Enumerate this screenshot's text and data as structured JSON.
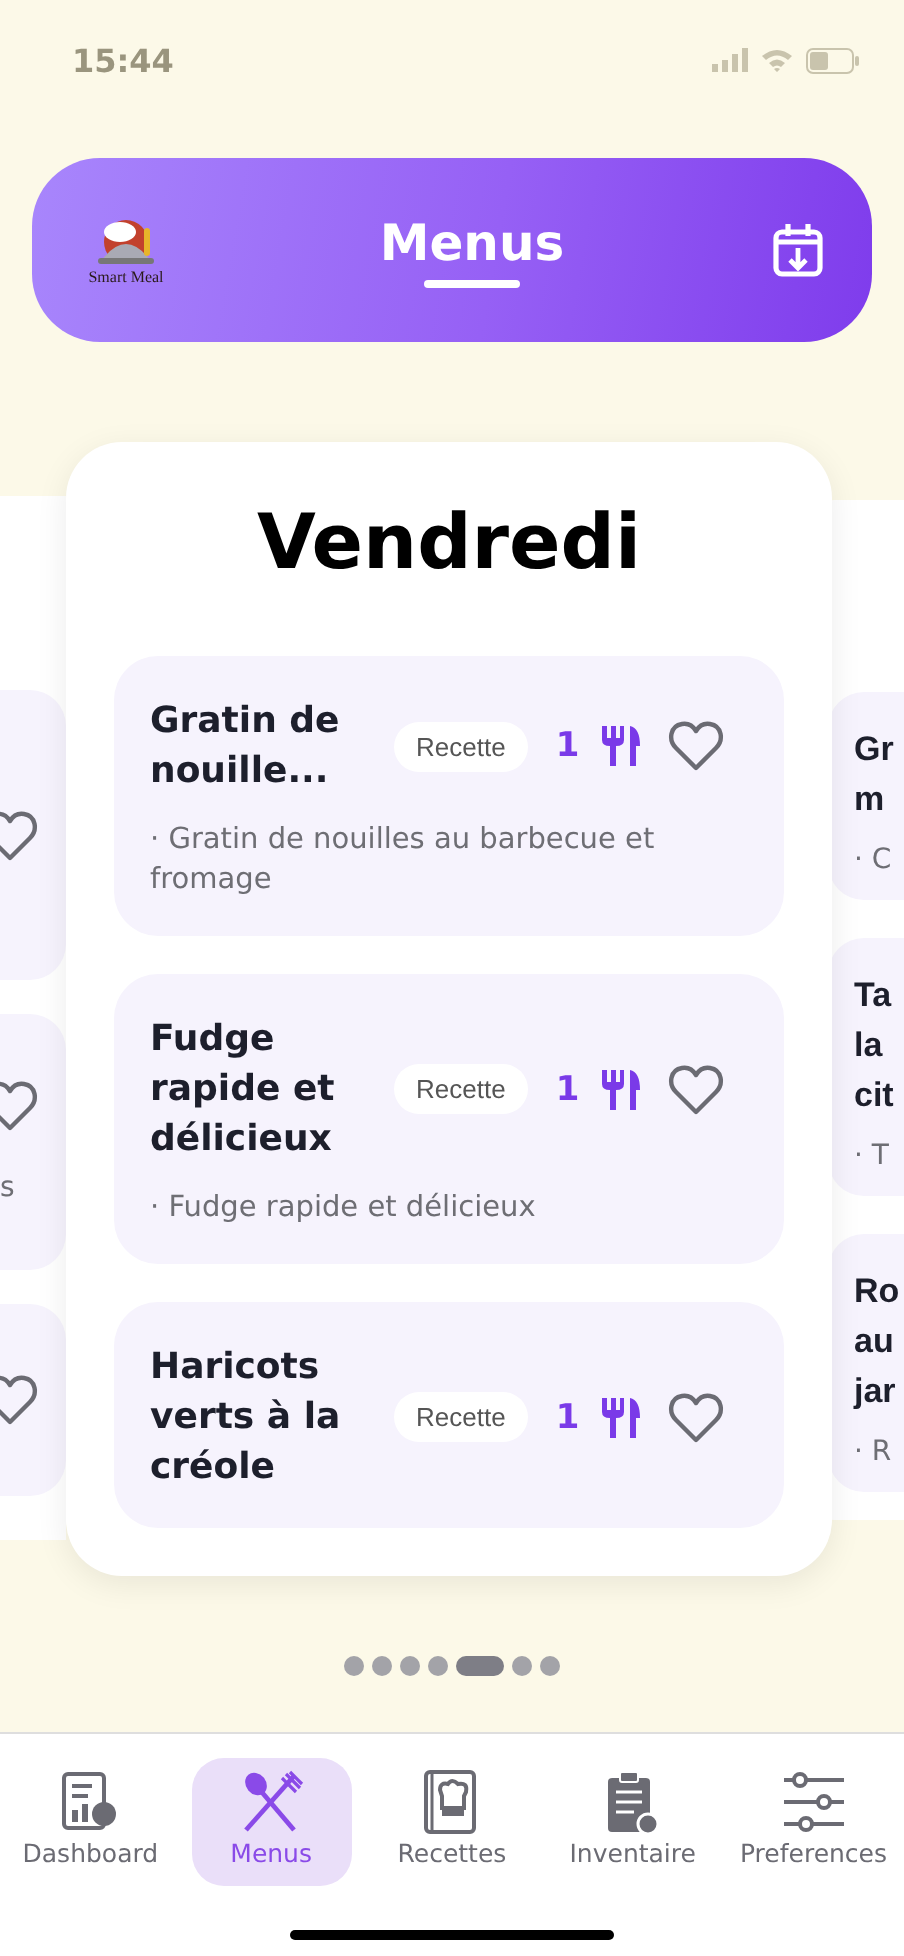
{
  "status_bar": {
    "time": "15:44"
  },
  "header": {
    "logo_text": "Smart Meal",
    "title": "Menus"
  },
  "previous_card": {
    "meals": [
      {
        "favorite": false
      },
      {
        "favorite": false,
        "description": "s"
      },
      {
        "favorite": false
      }
    ]
  },
  "day_card": {
    "day": "Vendredi",
    "meals": [
      {
        "title": "Gratin de nouille...",
        "badge": "Recette",
        "servings": "1",
        "favorite": false,
        "description": "· Gratin de nouilles au barbecue et fromage"
      },
      {
        "title": "Fudge rapide et délicieux",
        "badge": "Recette",
        "servings": "1",
        "favorite": false,
        "description": "· Fudge rapide et délicieux"
      },
      {
        "title": "Haricots verts à la créole",
        "badge": "Recette",
        "servings": "1",
        "favorite": false
      }
    ]
  },
  "next_card": {
    "meals": [
      {
        "title_lines": [
          "Gr",
          "m"
        ],
        "description": "· C"
      },
      {
        "title_lines": [
          "Ta",
          "la",
          "cit"
        ],
        "description": "· T"
      },
      {
        "title_lines": [
          "Ro",
          "au",
          "jar"
        ],
        "description": "· R"
      }
    ]
  },
  "pager": [
    {
      "selected": false
    },
    {
      "selected": false
    },
    {
      "selected": false
    },
    {
      "selected": false
    },
    {
      "selected": true
    },
    {
      "selected": false
    },
    {
      "selected": false
    }
  ],
  "nav": [
    {
      "kind": "dashboard",
      "label": "Dashboard",
      "selected": false
    },
    {
      "kind": "menus",
      "label": "Menus",
      "selected": true
    },
    {
      "kind": "recipes",
      "label": "Recettes",
      "selected": false
    },
    {
      "kind": "inventory",
      "label": "Inventaire",
      "selected": false
    },
    {
      "kind": "preferences",
      "label": "Preferences",
      "selected": false
    }
  ]
}
